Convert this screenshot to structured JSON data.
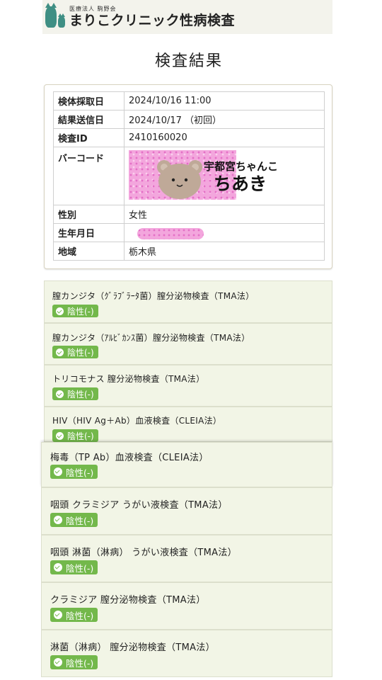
{
  "header": {
    "org_name": "医療法人 駒野会",
    "clinic_title": "まりこクリニック性病検査"
  },
  "page_title": "検査結果",
  "info": {
    "rows": [
      {
        "label": "検体採取日",
        "value": "2024/10/16  11:00"
      },
      {
        "label": "結果送信日",
        "value": "2024/10/17 （初回）"
      },
      {
        "label": "検査ID",
        "value": "2410160020"
      },
      {
        "label": "バーコード",
        "value": ""
      },
      {
        "label": "性別",
        "value": "女性"
      },
      {
        "label": "生年月日",
        "value": ""
      },
      {
        "label": "地域",
        "value": "栃木県"
      }
    ],
    "sticker_line1": "宇都宮ちゃんこ",
    "sticker_line2": "ちあき"
  },
  "tests": [
    {
      "name": "膣カンジタ（ｸﾞﾗﾌﾞﾗｰﾀ菌）膣分泌物検査（TMA法）",
      "result": "陰性(-)"
    },
    {
      "name": "膣カンジタ（ｱﾙﾋﾞｶﾝｽ菌）膣分泌物検査（TMA法）",
      "result": "陰性(-)"
    },
    {
      "name": "トリコモナス  膣分泌物検査（TMA法）",
      "result": "陰性(-)"
    },
    {
      "name": "HIV（HIV  Ag＋Ab）血液検査（CLEIA法）",
      "result": "陰性(-)"
    },
    {
      "name": "梅毒（TP  Ab）血液検査（CLEIA法）",
      "result": "陰性(-)"
    },
    {
      "name": "咽頭  クラミジア  うがい液検査（TMA法）",
      "result": "陰性(-)"
    },
    {
      "name": "咽頭  淋菌（淋病）  うがい液検査（TMA法）",
      "result": "陰性(-)"
    },
    {
      "name": "クラミジア  膣分泌物検査（TMA法）",
      "result": "陰性(-)"
    },
    {
      "name": "淋菌（淋病）  膣分泌物検査（TMA法）",
      "result": "陰性(-)"
    }
  ],
  "colors": {
    "accent": "#3f8f84",
    "badge_green": "#73b84b",
    "card_bg": "#f2f5e6"
  }
}
